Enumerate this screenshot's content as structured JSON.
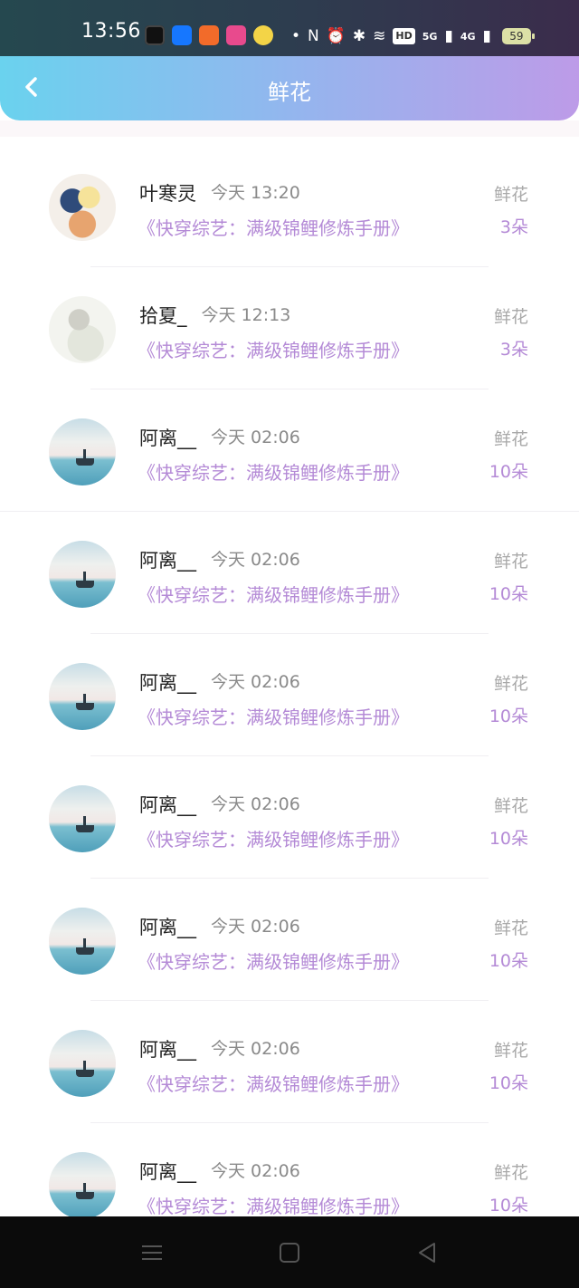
{
  "status_bar": {
    "time": "13:56",
    "app_icons": [
      {
        "name": "tiktok-icon",
        "color": "#111111"
      },
      {
        "name": "alipay-icon",
        "color": "#1677ff"
      },
      {
        "name": "app-grid-icon",
        "color": "#f26b2a"
      },
      {
        "name": "shop-icon",
        "color": "#e84a8d"
      },
      {
        "name": "chat-app-icon",
        "color": "#f3d447"
      }
    ],
    "hd_label": "HD",
    "signal_5g": "5G",
    "signal_4g": "4G",
    "battery": "59"
  },
  "header": {
    "title": "鲜花"
  },
  "colors": {
    "accent_purple": "#b48ad6",
    "header_gradient_start": "#6ad2ee",
    "header_gradient_end": "#bd9be8"
  },
  "items": [
    {
      "avatar": "anime",
      "name": "叶寒灵",
      "time": "今天 13:20",
      "book": "《快穿综艺：满级锦鲤修炼手册》",
      "gift": "鲜花",
      "count": "3朵"
    },
    {
      "avatar": "sketch",
      "name": "拾夏_",
      "time": "今天 12:13",
      "book": "《快穿综艺：满级锦鲤修炼手册》",
      "gift": "鲜花",
      "count": "3朵"
    },
    {
      "avatar": "sea",
      "name": "阿离__",
      "time": "今天 02:06",
      "book": "《快穿综艺：满级锦鲤修炼手册》",
      "gift": "鲜花",
      "count": "10朵"
    },
    {
      "avatar": "sea",
      "name": "阿离__",
      "time": "今天 02:06",
      "book": "《快穿综艺：满级锦鲤修炼手册》",
      "gift": "鲜花",
      "count": "10朵"
    },
    {
      "avatar": "sea",
      "name": "阿离__",
      "time": "今天 02:06",
      "book": "《快穿综艺：满级锦鲤修炼手册》",
      "gift": "鲜花",
      "count": "10朵"
    },
    {
      "avatar": "sea",
      "name": "阿离__",
      "time": "今天 02:06",
      "book": "《快穿综艺：满级锦鲤修炼手册》",
      "gift": "鲜花",
      "count": "10朵"
    },
    {
      "avatar": "sea",
      "name": "阿离__",
      "time": "今天 02:06",
      "book": "《快穿综艺：满级锦鲤修炼手册》",
      "gift": "鲜花",
      "count": "10朵"
    },
    {
      "avatar": "sea",
      "name": "阿离__",
      "time": "今天 02:06",
      "book": "《快穿综艺：满级锦鲤修炼手册》",
      "gift": "鲜花",
      "count": "10朵"
    },
    {
      "avatar": "sea",
      "name": "阿离__",
      "time": "今天 02:06",
      "book": "《快穿综艺：满级锦鲤修炼手册》",
      "gift": "鲜花",
      "count": "10朵"
    }
  ],
  "nav_bar": {
    "buttons": [
      "menu-icon",
      "home-icon",
      "back-triangle-icon"
    ]
  }
}
